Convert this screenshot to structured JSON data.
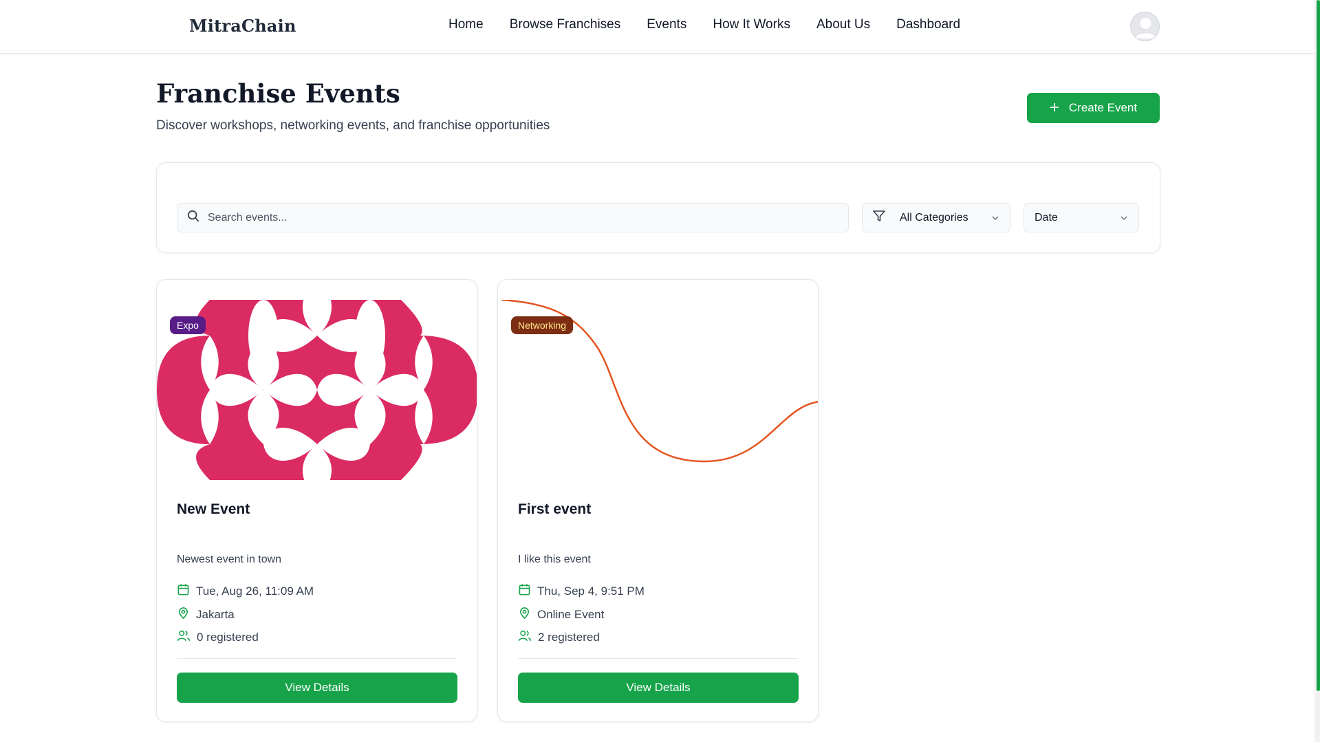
{
  "navbar": {
    "brand": "MitraChain",
    "links": [
      "Home",
      "Browse Franchises",
      "Events",
      "How It Works",
      "About Us",
      "Dashboard"
    ],
    "avatar_icon": "user-avatar-icon"
  },
  "header": {
    "title": "Franchise Events",
    "subtitle": "Discover workshops, networking events, and franchise opportunities",
    "create_button": "Create Event"
  },
  "filters": {
    "search_placeholder": "Search events...",
    "category_value": "All Categories",
    "sort_value": "Date"
  },
  "events": [
    {
      "badge": "Expo",
      "badge_color": "#581c87",
      "title": "New Event",
      "description": "Newest event in town",
      "date": "Tue, Aug 26, 11:09 AM",
      "location": "Jakarta",
      "registered": "0 registered",
      "button": "View Details",
      "image_icon": "pink-quatrefoil-pattern"
    },
    {
      "badge": "Networking",
      "badge_color": "#7c2d12",
      "title": "First event",
      "description": "I like this event",
      "date": "Thu, Sep 4, 9:51 PM",
      "location": "Online Event",
      "registered": "2 registered",
      "button": "View Details",
      "image_icon": "orange-wave-line"
    }
  ],
  "colors": {
    "accent": "#16a34a",
    "pattern_pink": "#db2b63",
    "wave_orange": "#e5541f"
  }
}
